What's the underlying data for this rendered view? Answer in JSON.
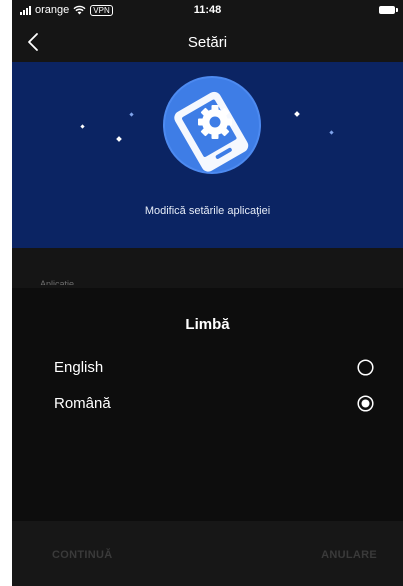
{
  "status_bar": {
    "carrier": "orange",
    "vpn_badge": "VPN",
    "time": "11:48"
  },
  "nav": {
    "title": "Setări"
  },
  "banner": {
    "caption": "Modifică setările aplicaţiei"
  },
  "section": {
    "label": "Aplicaţie"
  },
  "language_sheet": {
    "title": "Limbă",
    "options": [
      {
        "label": "English",
        "selected": false
      },
      {
        "label": "Română",
        "selected": true
      }
    ],
    "continue_label": "CONTINUĂ",
    "cancel_label": "ANULARE"
  },
  "colors": {
    "banner_bg": "#0b2463",
    "illustration_circle": "#3e7de6",
    "sheet_bg": "#0d0d0d",
    "footer_bg": "#171717"
  }
}
